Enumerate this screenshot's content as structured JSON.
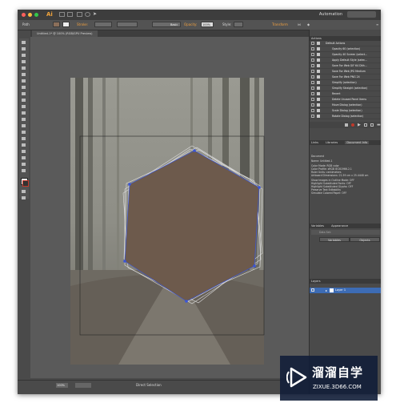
{
  "app": {
    "logo": "Ai",
    "workspace": "Automation"
  },
  "control": {
    "mode": "Path",
    "stroke_label": "Stroke:",
    "brush": "Basic",
    "opacity_label": "Opacity:",
    "opacity": "100%",
    "style_label": "Style:",
    "transform": "Transform"
  },
  "document": {
    "tab": "Untitled-1* @ 100% (RGB/GPU Preview)"
  },
  "status": {
    "zoom": "100%",
    "tool": "Direct Selection"
  },
  "actions": {
    "title": "Actions",
    "set": "Default Actions",
    "items": [
      "Opacity 60 (selection)",
      "Opacity 40 Screen (select...",
      "Apply Default Style (selec...",
      "Save For Web GIF 64 Dith...",
      "Save For Web JPG Medium",
      "Save For Web PNG 24",
      "Simplify (selection)",
      "Simplify Straight (selection)",
      "Revert",
      "Delete Unused Panel Items",
      "Move Dialog (selection)",
      "Scale Dialog (selection)",
      "Rotate Dialog (selection)"
    ]
  },
  "info_tabs": [
    "Links",
    "Libraries",
    "Document Info"
  ],
  "docinfo": [
    "Document",
    "Name: Untitled-1",
    "Color Mode: RGB color",
    "Color Profile: sRGB IEC61966-2.1",
    "Ruler Units: centimeters",
    "Artboard Dimensions: 21.59 cm x 25.4448 cm",
    "Show Images in Outline Mode: OFF",
    "Highlight Substituted Fonts: OFF",
    "Highlight Substituted Glyphs: OFF",
    "Preserve Text Editability",
    "Simulate Colored Paper: OFF"
  ],
  "variables": {
    "tabs": [
      "Variables",
      "Appearance"
    ],
    "data_set": "Data Set:",
    "btn_vars": "Variables",
    "btn_objects": "Objects"
  },
  "layers": {
    "title": "Layers",
    "layer": "Layer 1"
  },
  "watermark": {
    "brand": "溜溜自学",
    "url": "ZIXUE.3D66.COM"
  },
  "colors": {
    "hexagon": "#6d5a4c",
    "anchor": "#3a55d8",
    "accent": "#3d6cb5"
  }
}
